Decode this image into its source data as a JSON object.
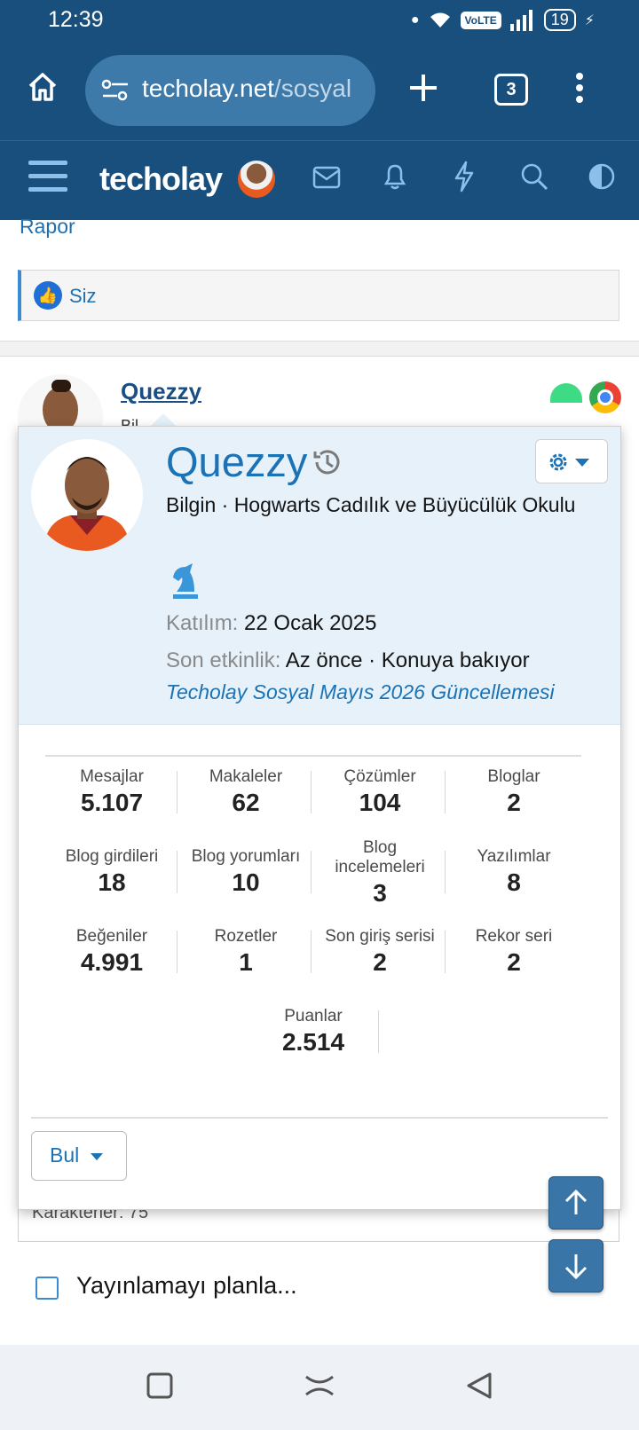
{
  "status_bar": {
    "time": "12:39",
    "network": "VoLTE",
    "battery": "19"
  },
  "browser": {
    "url_host": "techolay.net",
    "url_path": "/sosyal",
    "tab_count": "3"
  },
  "site": {
    "logo": "techolay"
  },
  "page": {
    "report_link": "Rapor",
    "reaction_label": "Siz",
    "post_username": "Quezzy",
    "post_rank_partial": "Bil",
    "characters_label": "Karakterler: 75",
    "schedule_label": "Yayınlamayı planla..."
  },
  "profile_card": {
    "username": "Quezzy",
    "rank": "Bilgin · Hogwarts Cadılık ve Büyücülük Okulu",
    "joined_label": "Katılım:",
    "joined_value": "22 Ocak 2025",
    "last_activity_label": "Son etkinlik:",
    "last_activity_value": "Az önce · Konuya bakıyor",
    "thread_link": "Techolay Sosyal Mayıs 2026 Güncellemesi",
    "find_button": "Bul",
    "stats": [
      {
        "label": "Mesajlar",
        "value": "5.107"
      },
      {
        "label": "Makaleler",
        "value": "62"
      },
      {
        "label": "Çözümler",
        "value": "104"
      },
      {
        "label": "Bloglar",
        "value": "2"
      },
      {
        "label": "Blog girdileri",
        "value": "18"
      },
      {
        "label": "Blog yorumları",
        "value": "10"
      },
      {
        "label": "Blog incelemeleri",
        "value": "3"
      },
      {
        "label": "Yazılımlar",
        "value": "8"
      },
      {
        "label": "Beğeniler",
        "value": "4.991"
      },
      {
        "label": "Rozetler",
        "value": "1"
      },
      {
        "label": "Son giriş serisi",
        "value": "2"
      },
      {
        "label": "Rekor seri",
        "value": "2"
      },
      {
        "label": "Puanlar",
        "value": "2.514"
      }
    ]
  }
}
